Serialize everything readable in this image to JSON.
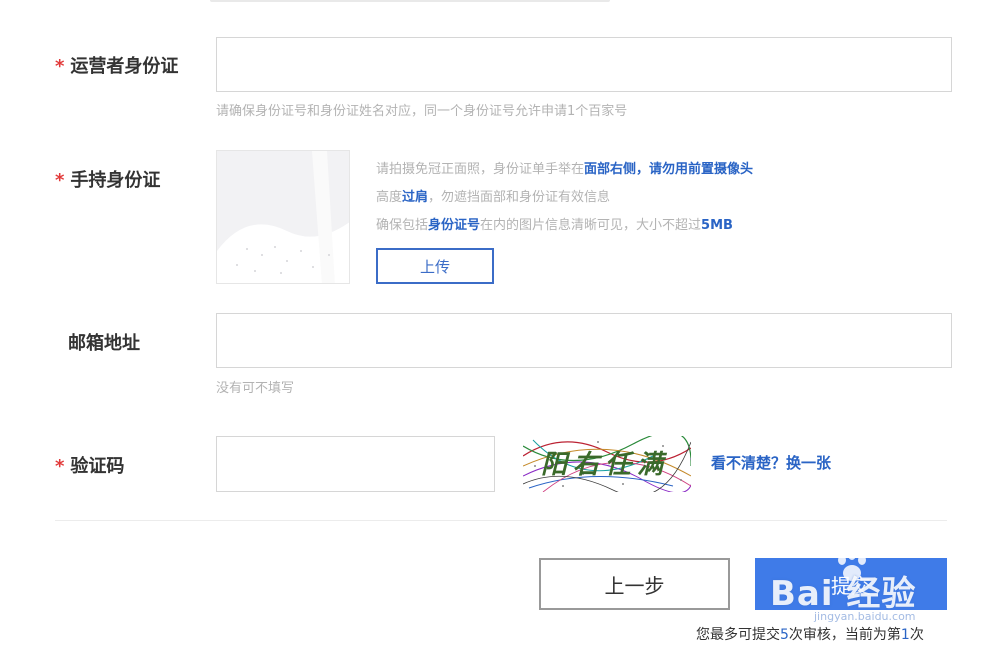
{
  "form": {
    "operator_id": {
      "required_mark": "*",
      "label": "运营者身份证",
      "value": "",
      "hint": "请确保身份证号和身份证姓名对应，同一个身份证号允许申请1个百家号"
    },
    "handheld_id": {
      "required_mark": "*",
      "label": "手持身份证",
      "tips": {
        "line1": {
          "pre": "请拍摄免冠正面照，身份证单手举在",
          "hl1": "面部右侧",
          "mid": "，",
          "hl2": "请勿用前置摄像头"
        },
        "line2": {
          "pre": "高度",
          "hl": "过肩",
          "post": "，勿遮挡面部和身份证有效信息"
        },
        "line3": {
          "pre": "确保包括",
          "hl1": "身份证号",
          "mid": "在内的图片信息清晰可见，大小不超过",
          "hl2": "5MB"
        }
      },
      "upload_label": "上传"
    },
    "email": {
      "label": "邮箱地址",
      "value": "",
      "hint": "没有可不填写"
    },
    "captcha": {
      "required_mark": "*",
      "label": "验证码",
      "value": "",
      "image_text": "阳右任满",
      "refresh_label": "看不清楚？换一张"
    }
  },
  "actions": {
    "prev_label": "上一步",
    "submit_label": "提交"
  },
  "submit_note": {
    "pre": "您最多可提交",
    "max": "5",
    "mid": "次审核，当前为第",
    "current": "1",
    "post": "次"
  },
  "watermark": {
    "text": "Bai 经验",
    "url": "jingyan.baidu.com"
  },
  "colors": {
    "required": "#e23b3b",
    "link": "#2a64c5",
    "primary_button": "#3f7be8",
    "hint": "#b3b3b3"
  }
}
